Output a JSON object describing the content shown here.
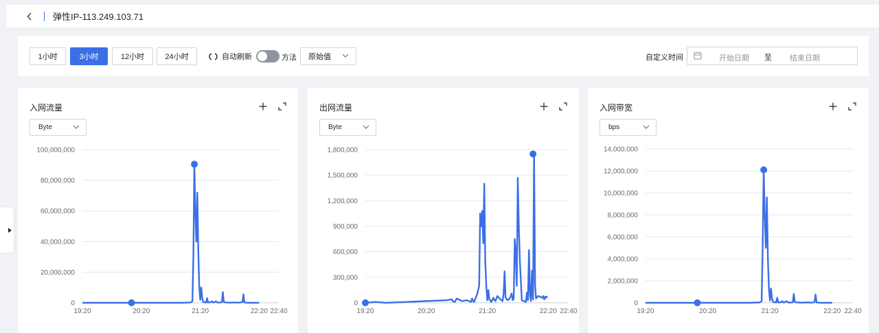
{
  "header": {
    "title": "弹性IP-113.249.103.71"
  },
  "toolbar": {
    "ranges": [
      "1小时",
      "3小时",
      "12小时",
      "24小时"
    ],
    "active_range_index": 1,
    "auto_refresh_label": "自动刷新",
    "auto_refresh_on": false,
    "method_label": "方法",
    "method_value": "原始值",
    "custom_time_label": "自定义时间",
    "start_placeholder": "开始日期",
    "range_separator": "至",
    "end_placeholder": "结束日期"
  },
  "colors": {
    "accent": "#3b6fe6",
    "series": "#3b6fe6",
    "grid": "#e5e6eb"
  },
  "cards": [
    {
      "title": "入网流量",
      "unit": "Byte"
    },
    {
      "title": "出网流量",
      "unit": "Byte"
    },
    {
      "title": "入网带宽",
      "unit": "bps"
    }
  ],
  "chart_data": [
    {
      "type": "line",
      "title": "入网流量",
      "ylim": [
        0,
        100000000
      ],
      "yticks": [
        0,
        20000000,
        40000000,
        60000000,
        80000000,
        100000000
      ],
      "ytick_labels": [
        "0",
        "20,000,000",
        "40,000,000",
        "60,000,000",
        "80,000,000",
        "100,000,000"
      ],
      "xtick_labels": [
        "19:20",
        "20:20",
        "21:20",
        "22:20",
        "22:40"
      ],
      "xlim_minutes": [
        0,
        200
      ],
      "xticks_minutes": [
        0,
        60,
        120,
        180,
        200
      ],
      "series": [
        {
          "x": [
            0,
            20,
            40,
            60,
            80,
            100,
            110,
            112,
            113,
            114,
            115,
            116,
            117,
            118,
            119,
            120,
            121,
            122,
            123,
            124,
            125,
            126,
            127,
            128,
            130,
            132,
            133,
            134,
            136,
            138,
            140,
            142,
            143,
            144,
            146,
            150,
            155,
            160,
            163,
            164,
            165,
            167,
            170,
            180
          ],
          "y": [
            0,
            0,
            0,
            0,
            0,
            0,
            200000,
            1000000,
            30000000,
            90500000,
            60000000,
            40000000,
            72000000,
            35000000,
            10000000,
            2000000,
            10000000,
            3000000,
            500000,
            500000,
            300000,
            200000,
            3000000,
            200000,
            300000,
            1000000,
            200000,
            300000,
            1000000,
            100000,
            200000,
            300000,
            7000000,
            500000,
            200000,
            100000,
            200000,
            100000,
            500000,
            5500000,
            200000,
            100000,
            0,
            0
          ]
        }
      ],
      "markers": [
        {
          "x": 50,
          "y": 0
        },
        {
          "x": 114,
          "y": 90500000
        }
      ]
    },
    {
      "type": "line",
      "title": "出网流量",
      "ylim": [
        0,
        1800000
      ],
      "yticks": [
        0,
        300000,
        600000,
        900000,
        1200000,
        1500000,
        1800000
      ],
      "ytick_labels": [
        "0",
        "300,000",
        "600,000",
        "900,000",
        "1,200,000",
        "1,500,000",
        "1,800,000"
      ],
      "xtick_labels": [
        "19:20",
        "20:20",
        "21:20",
        "22:20",
        "22:40"
      ],
      "xlim_minutes": [
        0,
        200
      ],
      "xticks_minutes": [
        0,
        60,
        120,
        180,
        200
      ],
      "series": [
        {
          "x": [
            0,
            10,
            20,
            40,
            60,
            80,
            85,
            86,
            88,
            90,
            95,
            100,
            104,
            105,
            106,
            107,
            110,
            112,
            113,
            114,
            115,
            116,
            117,
            118,
            119,
            120,
            121,
            122,
            124,
            126,
            127,
            128,
            130,
            132,
            135,
            136,
            137,
            138,
            140,
            142,
            144,
            145,
            146,
            147,
            148,
            149,
            150,
            151,
            152,
            154,
            156,
            158,
            159,
            160,
            161,
            162,
            163,
            164,
            165,
            166,
            167,
            168,
            170,
            172,
            174,
            175,
            176,
            177,
            178,
            179
          ],
          "y": [
            0,
            10000,
            0,
            10000,
            20000,
            30000,
            40000,
            20000,
            10000,
            50000,
            20000,
            30000,
            10000,
            50000,
            20000,
            10000,
            100000,
            200000,
            1050000,
            900000,
            1080000,
            700000,
            1400000,
            500000,
            200000,
            30000,
            150000,
            40000,
            10000,
            60000,
            30000,
            20000,
            80000,
            50000,
            20000,
            100000,
            370000,
            60000,
            30000,
            50000,
            110000,
            30000,
            50000,
            750000,
            600000,
            200000,
            1470000,
            900000,
            500000,
            30000,
            20000,
            10000,
            120000,
            30000,
            620000,
            80000,
            20000,
            380000,
            40000,
            1750000,
            200000,
            50000,
            80000,
            70000,
            60000,
            80000,
            40000,
            70000,
            60000,
            80000
          ]
        }
      ],
      "markers": [
        {
          "x": 0,
          "y": 0
        },
        {
          "x": 165,
          "y": 1750000
        }
      ]
    },
    {
      "type": "line",
      "title": "入网带宽",
      "ylim": [
        0,
        14000000
      ],
      "yticks": [
        0,
        2000000,
        4000000,
        6000000,
        8000000,
        10000000,
        12000000,
        14000000
      ],
      "ytick_labels": [
        "0",
        "2,000,000",
        "4,000,000",
        "6,000,000",
        "8,000,000",
        "10,000,000",
        "12,000,000",
        "14,000,000"
      ],
      "xtick_labels": [
        "19:20",
        "20:20",
        "21:20",
        "22:20",
        "22:40"
      ],
      "xlim_minutes": [
        0,
        200
      ],
      "xticks_minutes": [
        0,
        60,
        120,
        180,
        200
      ],
      "series": [
        {
          "x": [
            0,
            20,
            40,
            60,
            80,
            100,
            110,
            112,
            113,
            114,
            115,
            116,
            117,
            118,
            119,
            120,
            121,
            122,
            123,
            124,
            125,
            126,
            127,
            128,
            130,
            132,
            133,
            134,
            136,
            138,
            140,
            142,
            143,
            144,
            146,
            150,
            155,
            160,
            163,
            164,
            165,
            167,
            170,
            180
          ],
          "y": [
            0,
            0,
            0,
            0,
            0,
            0,
            30000,
            150000,
            5000000,
            12100000,
            8000000,
            5000000,
            9600000,
            4000000,
            1300000,
            200000,
            1300000,
            400000,
            80000,
            60000,
            40000,
            30000,
            450000,
            30000,
            40000,
            150000,
            30000,
            40000,
            150000,
            15000,
            30000,
            40000,
            800000,
            60000,
            30000,
            15000,
            30000,
            15000,
            60000,
            750000,
            30000,
            15000,
            0,
            0
          ]
        }
      ],
      "markers": [
        {
          "x": 50,
          "y": 0
        },
        {
          "x": 114,
          "y": 12100000
        }
      ]
    }
  ]
}
